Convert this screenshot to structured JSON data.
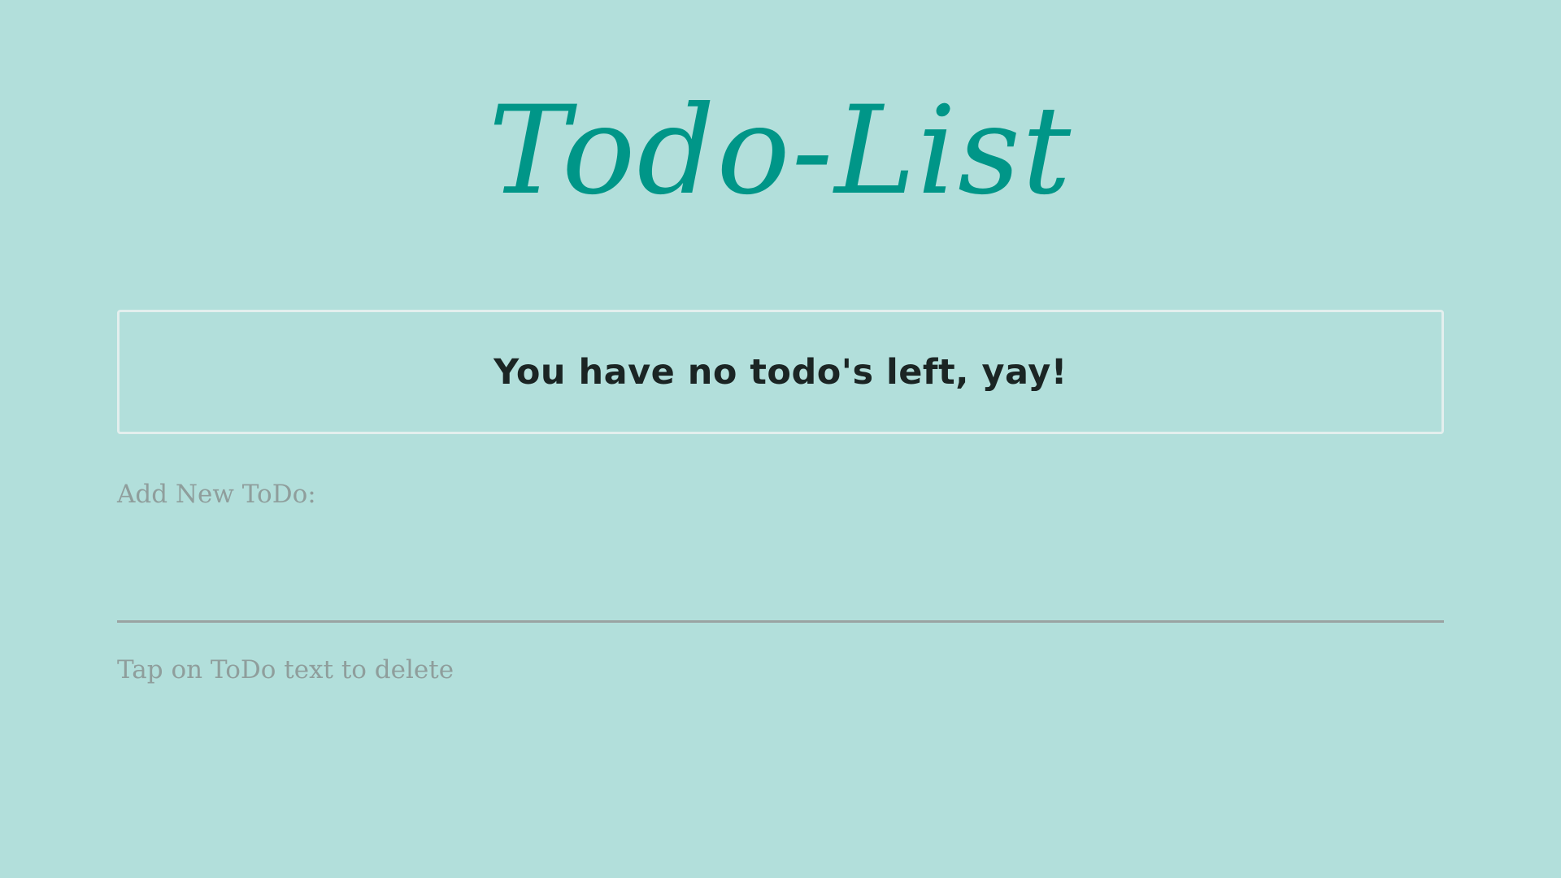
{
  "app": {
    "title": "Todo-List"
  },
  "status": {
    "message": "You have no todo's left, yay!"
  },
  "add_todo": {
    "label": "Add New ToDo:",
    "value": "",
    "placeholder": ""
  },
  "hint": {
    "text": "Tap on ToDo text to delete"
  },
  "colors": {
    "background": "#b2dfdb",
    "accent": "#009688",
    "muted_text": "#8f9e9c",
    "dark_text": "#1b2524"
  }
}
